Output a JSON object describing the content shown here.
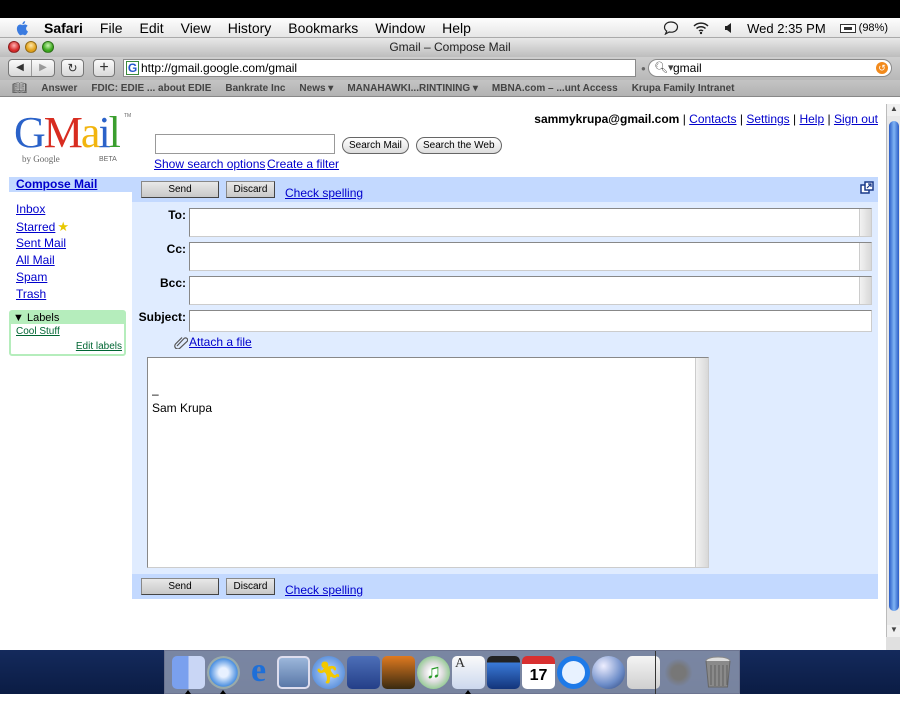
{
  "menubar": {
    "app_name": "Safari",
    "items": [
      "File",
      "Edit",
      "View",
      "History",
      "Bookmarks",
      "Window",
      "Help"
    ],
    "clock": "Wed 2:35 PM",
    "battery": "(98%)",
    "status_icons": [
      "ichat-icon",
      "wifi-icon",
      "volume-icon",
      "battery-icon"
    ]
  },
  "window": {
    "title": "Gmail – Compose Mail",
    "url": "http://gmail.google.com/gmail",
    "search_value": "gmail",
    "bookmarks": [
      "Answer",
      "FDIC: EDIE ... about EDIE",
      "Bankrate Inc",
      "News ▾",
      "MANAHAWKI...RINTINING ▾",
      "MBNA.com – ...unt Access",
      "Krupa Family Intranet"
    ]
  },
  "gmail": {
    "logo_text": "Gmail",
    "logo_by": "by Google",
    "logo_beta": "BETA",
    "logo_tm": "TM",
    "search_placeholder": "",
    "search_mail_label": "Search Mail",
    "search_web_label": "Search the Web",
    "show_search_options": "Show search options",
    "create_filter": "Create a filter",
    "account": {
      "email": "sammykrupa@gmail.com",
      "links": [
        "Contacts",
        "Settings",
        "Help",
        "Sign out"
      ],
      "separator": " | "
    },
    "nav": {
      "compose": "Compose Mail",
      "items": [
        "Inbox",
        "Starred",
        "Sent Mail",
        "All Mail",
        "Spam",
        "Trash"
      ]
    },
    "labels": {
      "header": "Labels",
      "items": [
        "Cool Stuff"
      ],
      "edit": "Edit labels"
    },
    "compose": {
      "send_label": "Send",
      "discard_label": "Discard",
      "check_spelling": "Check spelling",
      "to_label": "To:",
      "cc_label": "Cc:",
      "bcc_label": "Bcc:",
      "subject_label": "Subject:",
      "to_value": "",
      "cc_value": "",
      "bcc_value": "",
      "subject_value": "",
      "attach_label": "Attach a file",
      "body_lines": [
        "",
        "",
        "–",
        "Sam Krupa"
      ]
    }
  },
  "dock": {
    "apps": [
      "Finder",
      "Safari",
      "Internet Explorer",
      "Mail",
      "iChat / AIM",
      "Dashboard",
      "iPhoto",
      "iTunes",
      "TextEdit",
      "iMovie",
      "iCal",
      "QuickTime",
      "Network Globe",
      "System Preferences",
      "Sherlock"
    ],
    "running": [
      "Finder",
      "Safari",
      "TextEdit"
    ],
    "trash": "Trash"
  },
  "colors": {
    "gmail_blue_bar": "#c3d9ff",
    "compose_bg": "#e0ecff",
    "link": "#0000cc",
    "labels_green": "#b5edbc"
  }
}
